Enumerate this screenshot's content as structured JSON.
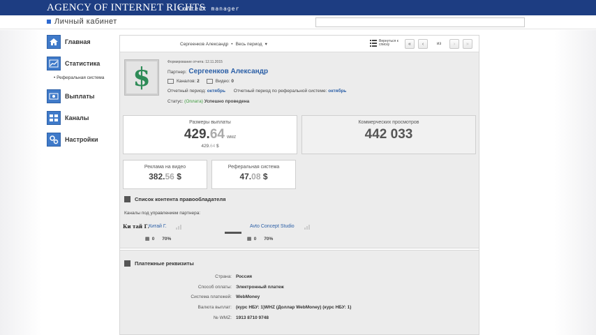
{
  "header": {
    "logo_main": "AGENCY OF INTERNET RIGHTS",
    "logo_sub": "Content manager",
    "cabinet": "Личный кабинет",
    "search_placeholder": ""
  },
  "sidebar": {
    "items": [
      {
        "label": "Главная",
        "icon": "home-icon"
      },
      {
        "label": "Статистика",
        "icon": "chart-icon"
      },
      {
        "label": "Выплаты",
        "icon": "money-icon"
      },
      {
        "label": "Каналы",
        "icon": "channels-icon"
      },
      {
        "label": "Настройки",
        "icon": "gear-icon"
      }
    ],
    "subitem": "• Реферальная система"
  },
  "toolbar": {
    "partner": "Сергеенков Александр",
    "period": "Весь период",
    "back_label": "Вернуться к списку",
    "page": "из"
  },
  "report": {
    "generated": "Формирование отчета: 12.11.2015",
    "partner_label": "Партнер:",
    "partner_name": "Сергеенков Александр",
    "channels_label": "Каналов:",
    "channels_count": "2",
    "videos_label": "Видео:",
    "videos_count": "0",
    "period_label": "Отчетный период:",
    "period_value": "октябрь",
    "ref_period_label": "Отчетный период по реферальной системе:",
    "ref_period_value": "октябрь",
    "status_label": "Статус:",
    "status_paid": "(Оплата)",
    "status_value": "Успешно проведена"
  },
  "cards": {
    "payout_title": "Размеры выплаты",
    "payout_int": "429.",
    "payout_dec": "64",
    "payout_unit": "WMZ",
    "payout_usd_int": "429.",
    "payout_usd_dec": "64",
    "payout_usd_unit": "$",
    "views_title": "Коммерческих просмотров",
    "views_value": "442 033",
    "ads_title": "Реклама на видео",
    "ads_int": "382.",
    "ads_dec": "56",
    "ads_unit": "$",
    "ref_title": "Реферальная система",
    "ref_int": "47.",
    "ref_dec": "08",
    "ref_unit": "$"
  },
  "content_list": {
    "title": "Список контента правообладателя",
    "channels_label": "Каналы под управлением партнера:",
    "channels": [
      {
        "name": "Китай Г.",
        "thumb": "Ки тай Г.",
        "videos": "0",
        "percent": "70%"
      },
      {
        "name": "Avto Concept Studio",
        "thumb": "",
        "videos": "0",
        "percent": "70%"
      }
    ]
  },
  "payment": {
    "title": "Платежные реквизиты",
    "rows": [
      {
        "key": "Страна:",
        "value": "Россия"
      },
      {
        "key": "Способ оплаты:",
        "value": "Электронный платеж"
      },
      {
        "key": "Система платежей:",
        "value": "WebMoney"
      },
      {
        "key": "Валюта выплат:",
        "value": "(курс НБУ: 1)WHZ (Доллар WebMoney) (курс НБУ: 1)"
      },
      {
        "key": "№ WMZ:",
        "value": "1913 8710 9748"
      }
    ]
  }
}
